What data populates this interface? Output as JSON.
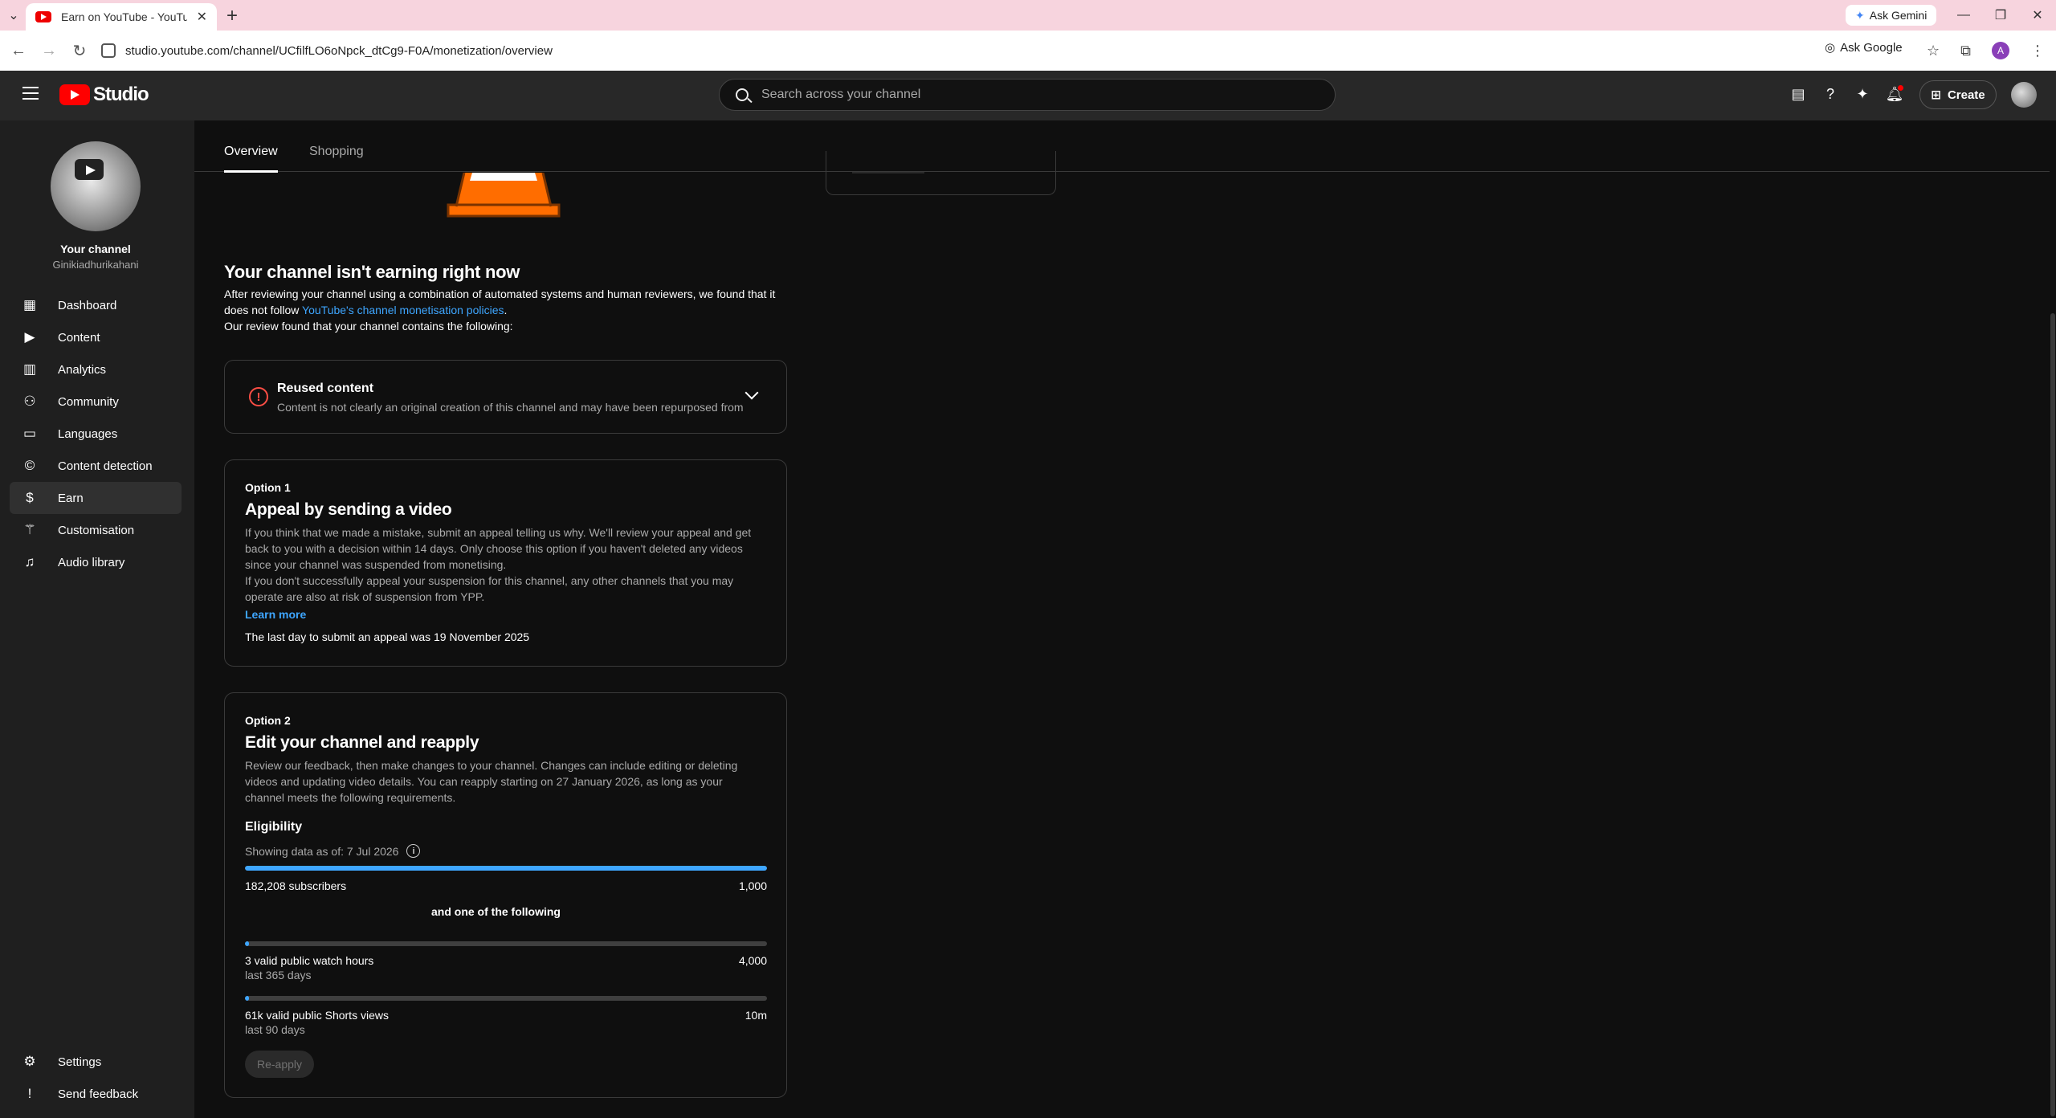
{
  "browser": {
    "tab_title": "Earn on YouTube - YouTube St...",
    "new_tab": "+",
    "ask_gemini": "Ask Gemini",
    "url": "studio.youtube.com/channel/UCfilfLO6oNpck_dtCg9-F0A/monetization/overview",
    "ask_google": "Ask Google",
    "profile_initial": "A"
  },
  "header": {
    "logo_text": "Studio",
    "search_placeholder": "Search across your channel",
    "create_label": "Create"
  },
  "sidebar": {
    "channel_title": "Your channel",
    "channel_name": "Ginikiadhurikahani",
    "items": [
      {
        "label": "Dashboard",
        "icon": "dashboard-icon"
      },
      {
        "label": "Content",
        "icon": "content-icon"
      },
      {
        "label": "Analytics",
        "icon": "analytics-icon"
      },
      {
        "label": "Community",
        "icon": "community-icon"
      },
      {
        "label": "Languages",
        "icon": "subtitles-icon"
      },
      {
        "label": "Content detection",
        "icon": "copyright-icon"
      },
      {
        "label": "Earn",
        "icon": "dollar-icon",
        "active": true
      },
      {
        "label": "Customisation",
        "icon": "magic-wand-icon"
      },
      {
        "label": "Audio library",
        "icon": "audio-library-icon"
      }
    ],
    "bottom": [
      {
        "label": "Settings",
        "icon": "gear-icon"
      },
      {
        "label": "Send feedback",
        "icon": "feedback-icon"
      }
    ]
  },
  "tabs": [
    {
      "label": "Overview",
      "active": true
    },
    {
      "label": "Shopping",
      "active": false
    }
  ],
  "main": {
    "title": "Your channel isn't earning right now",
    "intro_1": "After reviewing your channel using a combination of automated systems and human reviewers, we found that it does not follow ",
    "intro_link": "YouTube's channel monetisation policies",
    "intro_2": ".",
    "intro_3": "Our review found that your channel contains the following:",
    "reused_title": "Reused content",
    "reused_desc": "Content is not clearly an original creation of this channel and may have been repurposed from",
    "option1": {
      "label": "Option 1",
      "title": "Appeal by sending a video",
      "p1": "If you think that we made a mistake, submit an appeal telling us why. We'll review your appeal and get back to you with a decision within 14 days. Only choose this option if you haven't deleted any videos since your channel was suspended from monetising.",
      "p2": "If you don't successfully appeal your suspension for this channel, any other channels that you may operate are also at risk of suspension from YPP.",
      "learn_more": "Learn more",
      "last_day": "The last day to submit an appeal was 19 November 2025"
    },
    "option2": {
      "label": "Option 2",
      "title": "Edit your channel and reapply",
      "p1": "Review our feedback, then make changes to your channel. Changes can include editing or deleting videos and updating video details. You can reapply starting on 27 January 2026, as long as your channel meets the following requirements.",
      "eligibility": "Eligibility",
      "as_of": "Showing data as of: 7 Jul 2026",
      "subs_label": "182,208 subscribers",
      "subs_target": "1,000",
      "subs_progress": 1.0,
      "and_one": "and one of the following",
      "watch_label": "3 valid public watch hours",
      "watch_target": "4,000",
      "watch_sub": "last 365 days",
      "watch_progress": 0.001,
      "shorts_label": "61k valid public Shorts views",
      "shorts_target": "10m",
      "shorts_sub": "last 90 days",
      "shorts_progress": 0.006,
      "reapply_label": "Re-apply"
    }
  },
  "colors": {
    "accent": "#3ea6ff",
    "alert": "#ff4e45",
    "background": "#0f0f0f",
    "sidebar": "#1f1f1f"
  }
}
